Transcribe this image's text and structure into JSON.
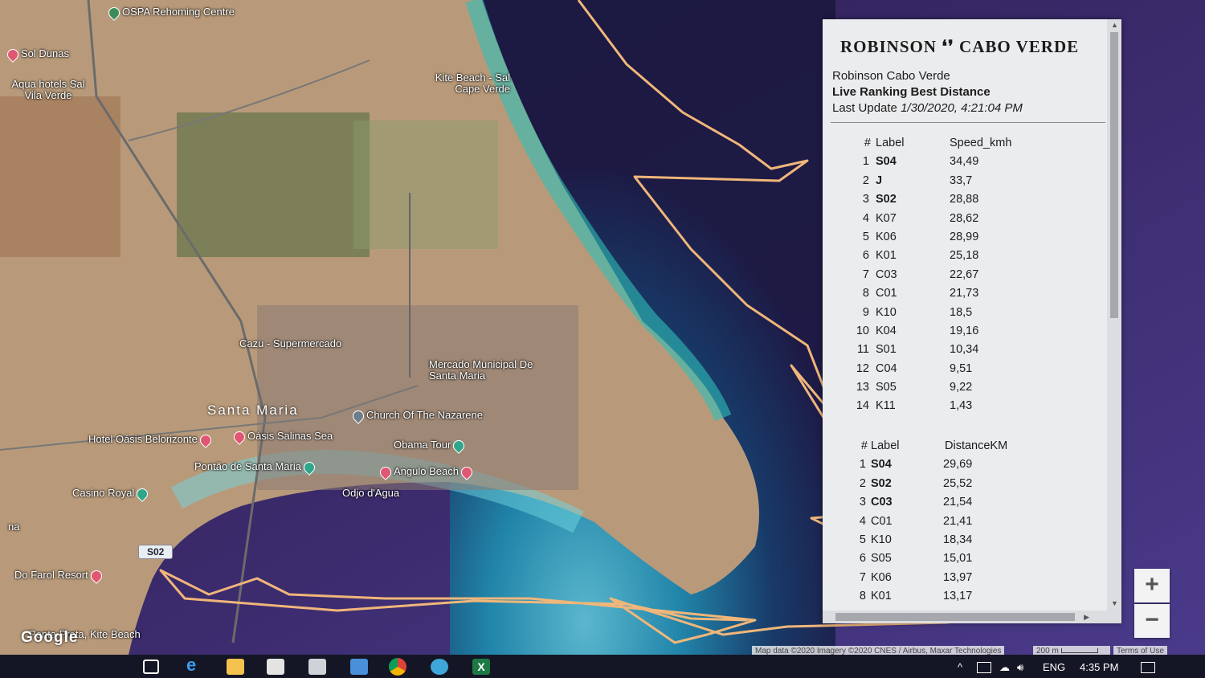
{
  "map": {
    "places": [
      {
        "name": "OSPA Rehoming Centre",
        "color": "#3d8b5a"
      },
      {
        "name": "Sol Dunas",
        "color": "#e05673"
      },
      {
        "name": "Aqua hotels Sal Vila Verde",
        "color": "#e05673"
      },
      {
        "name": "Kite Beach - Sal Cape Verde",
        "color": "#6f7d8a"
      },
      {
        "name": "Cazu - Supermercado",
        "color": "#3a7bd5"
      },
      {
        "name": "Mercado Municipal De Santa Maria",
        "color": "#3a7bd5"
      },
      {
        "name": "Church Of The Nazarene",
        "color": "#6f7d8a"
      },
      {
        "name": "Hotel Oásis Belorizonte",
        "color": "#e05673"
      },
      {
        "name": "Oásis Salinas Sea",
        "color": "#e05673"
      },
      {
        "name": "Obama Tour",
        "color": "#2fa58a"
      },
      {
        "name": "Pontão de Santa Maria",
        "color": "#2fa58a"
      },
      {
        "name": "Angulo Beach",
        "color": "#e05673"
      },
      {
        "name": "Odjo d'Agua",
        "color": "#e05673"
      },
      {
        "name": "Casino Royal",
        "color": "#2fa58a"
      },
      {
        "name": "Do Farol Resort",
        "color": "#e05673"
      },
      {
        "name": "Ponta Preta, Kite Beach",
        "color": "#2fa58a"
      },
      {
        "name": "na",
        "color": "#e05673"
      }
    ],
    "town": "Santa Maria",
    "track_tag": "S02",
    "google_logo": "Google",
    "zoom_in": "+",
    "zoom_out": "−",
    "attribution": "Map data ©2020 Imagery ©2020 CNES / Airbus, Maxar Technologies",
    "scale": "200 m",
    "terms": "Terms of Use",
    "track_color": "#f0b67a"
  },
  "panel": {
    "brand": "ROBINSON ❛❜ CABO VERDE",
    "subtitle": "Robinson Cabo Verde",
    "ranking_title": "Live Ranking Best Distance",
    "last_update_label": "Last Update",
    "last_update_value": "1/30/2020, 4:21:04 PM",
    "speed_table": {
      "headers": [
        "#",
        "Label",
        "Speed_kmh"
      ],
      "rows": [
        [
          "1",
          "S04",
          "34,49"
        ],
        [
          "2",
          "J",
          "33,7"
        ],
        [
          "3",
          "S02",
          "28,88"
        ],
        [
          "4",
          "K07",
          "28,62"
        ],
        [
          "5",
          "K06",
          "28,99"
        ],
        [
          "6",
          "K01",
          "25,18"
        ],
        [
          "7",
          "C03",
          "22,67"
        ],
        [
          "8",
          "C01",
          "21,73"
        ],
        [
          "9",
          "K10",
          "18,5"
        ],
        [
          "10",
          "K04",
          "19,16"
        ],
        [
          "11",
          "S01",
          "10,34"
        ],
        [
          "12",
          "C04",
          "9,51"
        ],
        [
          "13",
          "S05",
          "9,22"
        ],
        [
          "14",
          "K11",
          "1,43"
        ]
      ]
    },
    "distance_table": {
      "headers": [
        "#",
        "Label",
        "DistanceKM"
      ],
      "rows": [
        [
          "1",
          "S04",
          "29,69"
        ],
        [
          "2",
          "S02",
          "25,52"
        ],
        [
          "3",
          "C03",
          "21,54"
        ],
        [
          "4",
          "C01",
          "21,41"
        ],
        [
          "5",
          "K10",
          "18,34"
        ],
        [
          "6",
          "S05",
          "15,01"
        ],
        [
          "7",
          "K06",
          "13,97"
        ],
        [
          "8",
          "K01",
          "13,17"
        ]
      ]
    }
  },
  "taskbar": {
    "language": "ENG",
    "time": "4:35 PM"
  }
}
